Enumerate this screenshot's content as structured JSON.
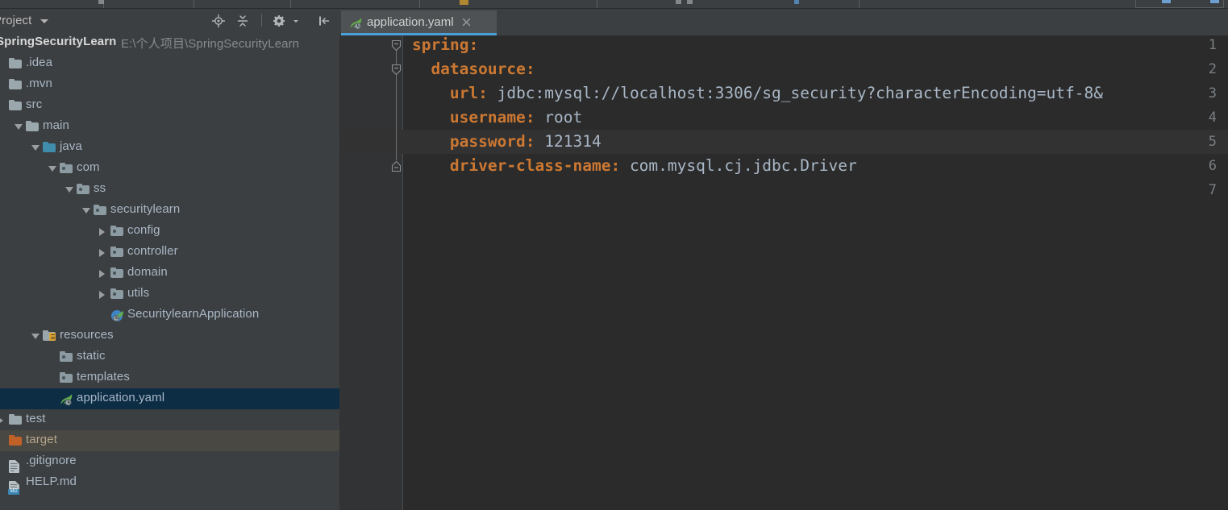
{
  "app": {
    "theme_bg": "#3c3f41",
    "editor_bg": "#2b2b2b",
    "accent": "#4a9fd8",
    "selection_bg": "#0d2d45",
    "keyword_color": "#cc7832",
    "value_color": "#a9b7c6"
  },
  "sidebar": {
    "panel_title": "Project",
    "header_icons": [
      {
        "name": "locate-target-icon",
        "label": "Select Opened File"
      },
      {
        "name": "collapse-all-icon",
        "label": "Collapse All"
      },
      {
        "name": "gear-icon",
        "label": "Settings"
      },
      {
        "name": "hide-panel-icon",
        "label": "Hide"
      }
    ],
    "tree": [
      {
        "label": "SpringSecurityLearn",
        "path_suffix": "E:\\个人项目\\SpringSecurityLearn",
        "icon": "project-root",
        "depth": 0,
        "arrow": "none",
        "state": "root"
      },
      {
        "label": ".idea",
        "icon": "folder-gray",
        "depth": 0,
        "arrow": "none",
        "state": "normal"
      },
      {
        "label": ".mvn",
        "icon": "folder-gray",
        "depth": 0,
        "arrow": "none",
        "state": "normal"
      },
      {
        "label": "src",
        "icon": "folder-gray",
        "depth": 0,
        "arrow": "none",
        "state": "normal"
      },
      {
        "label": "main",
        "icon": "folder-gray",
        "depth": 1,
        "arrow": "open",
        "state": "normal"
      },
      {
        "label": "java",
        "icon": "folder-source-blue",
        "depth": 2,
        "arrow": "open",
        "state": "normal"
      },
      {
        "label": "com",
        "icon": "package",
        "depth": 3,
        "arrow": "open",
        "state": "normal"
      },
      {
        "label": "ss",
        "icon": "package",
        "depth": 4,
        "arrow": "open",
        "state": "normal"
      },
      {
        "label": "securitylearn",
        "icon": "package",
        "depth": 5,
        "arrow": "open",
        "state": "normal"
      },
      {
        "label": "config",
        "icon": "package",
        "depth": 6,
        "arrow": "closed",
        "state": "normal"
      },
      {
        "label": "controller",
        "icon": "package",
        "depth": 6,
        "arrow": "closed",
        "state": "normal"
      },
      {
        "label": "domain",
        "icon": "package",
        "depth": 6,
        "arrow": "closed",
        "state": "normal"
      },
      {
        "label": "utils",
        "icon": "package",
        "depth": 6,
        "arrow": "closed",
        "state": "normal"
      },
      {
        "label": "SecuritylearnApplication",
        "icon": "spring-boot-class",
        "depth": 6,
        "arrow": "none",
        "state": "normal"
      },
      {
        "label": "resources",
        "icon": "folder-resources",
        "depth": 2,
        "arrow": "open",
        "state": "normal"
      },
      {
        "label": "static",
        "icon": "package",
        "depth": 3,
        "arrow": "none",
        "state": "normal"
      },
      {
        "label": "templates",
        "icon": "package",
        "depth": 3,
        "arrow": "none",
        "state": "normal"
      },
      {
        "label": "application.yaml",
        "icon": "spring-yaml",
        "depth": 3,
        "arrow": "none",
        "state": "selected"
      },
      {
        "label": "test",
        "icon": "folder-gray",
        "depth": 0,
        "arrow": "closed",
        "state": "normal"
      },
      {
        "label": "target",
        "icon": "folder-excluded-orange",
        "depth": 0,
        "arrow": "none",
        "state": "hover"
      },
      {
        "label": ".gitignore",
        "icon": "file-text",
        "depth": 0,
        "arrow": "none",
        "state": "normal"
      },
      {
        "label": "HELP.md",
        "icon": "file-markdown",
        "depth": 0,
        "arrow": "none",
        "state": "normal"
      }
    ]
  },
  "editor": {
    "tabs": [
      {
        "label": "application.yaml",
        "icon": "spring-yaml-icon",
        "active": true,
        "close_glyph": "×"
      }
    ],
    "caret_line": 5,
    "lines": [
      {
        "num": "1",
        "indent": 0,
        "key": "spring:",
        "value": "",
        "fold": "open-start"
      },
      {
        "num": "2",
        "indent": 2,
        "key": "datasource:",
        "value": "",
        "fold": "open-child"
      },
      {
        "num": "3",
        "indent": 4,
        "key": "url:",
        "value": " jdbc:mysql://localhost:3306/sg_security?characterEncoding=utf-8&",
        "fold": "none"
      },
      {
        "num": "4",
        "indent": 4,
        "key": "username:",
        "value": " root",
        "fold": "none"
      },
      {
        "num": "5",
        "indent": 4,
        "key": "password:",
        "value": " 121314",
        "fold": "none"
      },
      {
        "num": "6",
        "indent": 4,
        "key": "driver-class-name:",
        "value": " com.mysql.cj.jdbc.Driver",
        "fold": "end"
      },
      {
        "num": "7",
        "indent": 0,
        "key": "",
        "value": "",
        "fold": "none"
      }
    ]
  }
}
